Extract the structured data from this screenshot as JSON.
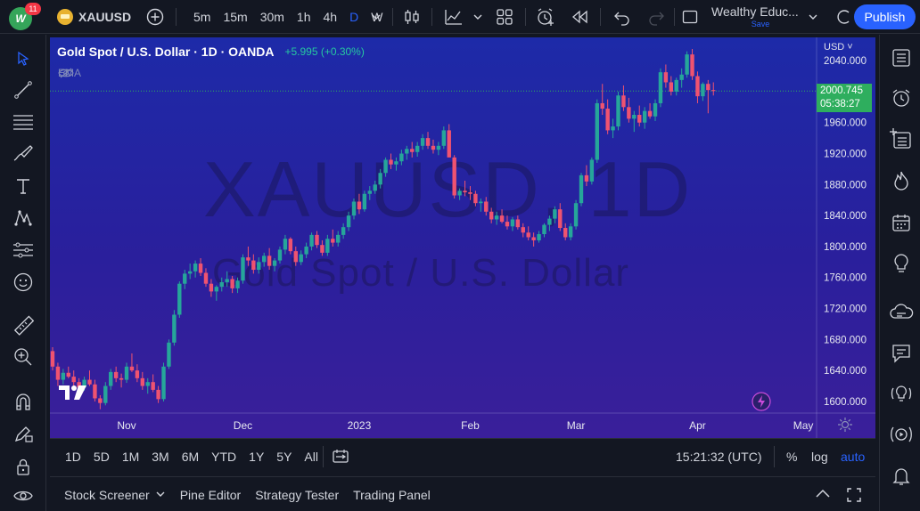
{
  "topbar": {
    "notifications": "11",
    "avatar_text": "W",
    "symbol": "XAUUSD",
    "intervals": [
      {
        "label": "5m",
        "active": false
      },
      {
        "label": "15m",
        "active": false
      },
      {
        "label": "30m",
        "active": false
      },
      {
        "label": "1h",
        "active": false
      },
      {
        "label": "4h",
        "active": false
      },
      {
        "label": "D",
        "active": true
      },
      {
        "label": "W",
        "active": false
      }
    ],
    "layout_name": "Wealthy Educ...",
    "layout_save": "Save",
    "publish_label": "Publish"
  },
  "legend": {
    "title": "Gold Spot / U.S. Dollar · 1D · OANDA",
    "change": "+5.995 (+0.30%)",
    "ema_label": "EMA"
  },
  "watermark": {
    "symbol_line": "XAUUSD, 1D",
    "name_line": "Gold Spot / U.S. Dollar"
  },
  "price_axis": {
    "currency": "USD",
    "last_price": "2000.745",
    "countdown": "05:38:27"
  },
  "chart_data": {
    "type": "candlestick",
    "ylim": [
      1585,
      2070
    ],
    "y_ticks": [
      1600,
      1640,
      1680,
      1720,
      1760,
      1800,
      1840,
      1880,
      1920,
      1960,
      2000,
      2040
    ],
    "x_labels": [
      {
        "label": "Nov",
        "index": 14
      },
      {
        "label": "Dec",
        "index": 36
      },
      {
        "label": "2023",
        "index": 58
      },
      {
        "label": "Feb",
        "index": 79
      },
      {
        "label": "Mar",
        "index": 99
      },
      {
        "label": "Apr",
        "index": 122
      },
      {
        "label": "May",
        "index": 142
      }
    ],
    "last_price": 2000.745,
    "candles": [
      [
        1665,
        1670,
        1640,
        1645
      ],
      [
        1645,
        1650,
        1620,
        1628
      ],
      [
        1628,
        1642,
        1622,
        1637
      ],
      [
        1637,
        1645,
        1630,
        1632
      ],
      [
        1632,
        1640,
        1620,
        1625
      ],
      [
        1625,
        1630,
        1612,
        1618
      ],
      [
        1618,
        1632,
        1614,
        1628
      ],
      [
        1628,
        1640,
        1620,
        1622
      ],
      [
        1622,
        1628,
        1600,
        1604
      ],
      [
        1604,
        1608,
        1590,
        1598
      ],
      [
        1598,
        1625,
        1595,
        1620
      ],
      [
        1620,
        1642,
        1615,
        1638
      ],
      [
        1638,
        1645,
        1625,
        1630
      ],
      [
        1630,
        1636,
        1618,
        1628
      ],
      [
        1628,
        1650,
        1624,
        1645
      ],
      [
        1645,
        1662,
        1638,
        1640
      ],
      [
        1640,
        1648,
        1625,
        1630
      ],
      [
        1630,
        1638,
        1615,
        1620
      ],
      [
        1620,
        1630,
        1610,
        1625
      ],
      [
        1625,
        1635,
        1612,
        1615
      ],
      [
        1615,
        1620,
        1598,
        1603
      ],
      [
        1603,
        1650,
        1600,
        1645
      ],
      [
        1645,
        1680,
        1642,
        1676
      ],
      [
        1676,
        1718,
        1672,
        1712
      ],
      [
        1712,
        1755,
        1708,
        1752
      ],
      [
        1752,
        1770,
        1745,
        1765
      ],
      [
        1765,
        1778,
        1758,
        1768
      ],
      [
        1768,
        1782,
        1760,
        1778
      ],
      [
        1778,
        1785,
        1762,
        1766
      ],
      [
        1766,
        1772,
        1748,
        1752
      ],
      [
        1752,
        1758,
        1735,
        1742
      ],
      [
        1742,
        1750,
        1730,
        1748
      ],
      [
        1748,
        1760,
        1742,
        1754
      ],
      [
        1754,
        1768,
        1748,
        1758
      ],
      [
        1758,
        1762,
        1740,
        1746
      ],
      [
        1746,
        1760,
        1740,
        1756
      ],
      [
        1756,
        1790,
        1752,
        1786
      ],
      [
        1786,
        1800,
        1775,
        1782
      ],
      [
        1782,
        1790,
        1765,
        1770
      ],
      [
        1770,
        1786,
        1765,
        1780
      ],
      [
        1780,
        1792,
        1774,
        1788
      ],
      [
        1788,
        1798,
        1770,
        1775
      ],
      [
        1775,
        1785,
        1768,
        1782
      ],
      [
        1782,
        1800,
        1778,
        1796
      ],
      [
        1796,
        1815,
        1790,
        1810
      ],
      [
        1810,
        1812,
        1790,
        1794
      ],
      [
        1794,
        1800,
        1775,
        1780
      ],
      [
        1780,
        1795,
        1776,
        1790
      ],
      [
        1790,
        1805,
        1785,
        1800
      ],
      [
        1800,
        1818,
        1795,
        1815
      ],
      [
        1815,
        1820,
        1798,
        1802
      ],
      [
        1802,
        1808,
        1788,
        1792
      ],
      [
        1792,
        1815,
        1788,
        1810
      ],
      [
        1810,
        1822,
        1800,
        1805
      ],
      [
        1805,
        1820,
        1800,
        1815
      ],
      [
        1815,
        1830,
        1810,
        1825
      ],
      [
        1825,
        1845,
        1820,
        1840
      ],
      [
        1840,
        1862,
        1835,
        1858
      ],
      [
        1858,
        1868,
        1842,
        1848
      ],
      [
        1848,
        1872,
        1845,
        1868
      ],
      [
        1868,
        1878,
        1860,
        1872
      ],
      [
        1872,
        1885,
        1868,
        1880
      ],
      [
        1880,
        1900,
        1875,
        1895
      ],
      [
        1895,
        1915,
        1890,
        1912
      ],
      [
        1912,
        1920,
        1900,
        1906
      ],
      [
        1906,
        1915,
        1898,
        1910
      ],
      [
        1910,
        1925,
        1905,
        1920
      ],
      [
        1920,
        1930,
        1912,
        1926
      ],
      [
        1926,
        1935,
        1915,
        1922
      ],
      [
        1922,
        1935,
        1916,
        1930
      ],
      [
        1930,
        1945,
        1925,
        1940
      ],
      [
        1940,
        1948,
        1926,
        1930
      ],
      [
        1930,
        1938,
        1920,
        1925
      ],
      [
        1925,
        1935,
        1918,
        1930
      ],
      [
        1930,
        1955,
        1926,
        1950
      ],
      [
        1950,
        1958,
        1920,
        1915
      ],
      [
        1915,
        1918,
        1862,
        1866
      ],
      [
        1866,
        1875,
        1860,
        1872
      ],
      [
        1872,
        1885,
        1865,
        1870
      ],
      [
        1870,
        1878,
        1860,
        1868
      ],
      [
        1868,
        1872,
        1852,
        1856
      ],
      [
        1856,
        1862,
        1845,
        1858
      ],
      [
        1858,
        1864,
        1840,
        1845
      ],
      [
        1845,
        1850,
        1830,
        1835
      ],
      [
        1835,
        1845,
        1828,
        1840
      ],
      [
        1840,
        1848,
        1830,
        1832
      ],
      [
        1832,
        1840,
        1822,
        1826
      ],
      [
        1826,
        1838,
        1820,
        1835
      ],
      [
        1835,
        1840,
        1822,
        1825
      ],
      [
        1825,
        1830,
        1812,
        1818
      ],
      [
        1818,
        1826,
        1808,
        1812
      ],
      [
        1812,
        1818,
        1800,
        1808
      ],
      [
        1808,
        1820,
        1805,
        1816
      ],
      [
        1816,
        1830,
        1812,
        1828
      ],
      [
        1828,
        1840,
        1820,
        1836
      ],
      [
        1836,
        1852,
        1830,
        1848
      ],
      [
        1848,
        1856,
        1820,
        1824
      ],
      [
        1824,
        1830,
        1808,
        1812
      ],
      [
        1812,
        1830,
        1808,
        1826
      ],
      [
        1826,
        1860,
        1822,
        1856
      ],
      [
        1856,
        1895,
        1852,
        1892
      ],
      [
        1892,
        1905,
        1878,
        1884
      ],
      [
        1884,
        1915,
        1880,
        1912
      ],
      [
        1912,
        1990,
        1908,
        1985
      ],
      [
        1985,
        2010,
        1970,
        1978
      ],
      [
        1978,
        1990,
        1945,
        1950
      ],
      [
        1950,
        1965,
        1940,
        1955
      ],
      [
        1955,
        2000,
        1950,
        1995
      ],
      [
        1995,
        2008,
        1975,
        1980
      ],
      [
        1980,
        1992,
        1960,
        1965
      ],
      [
        1965,
        1975,
        1948,
        1970
      ],
      [
        1970,
        1982,
        1955,
        1960
      ],
      [
        1960,
        1980,
        1952,
        1975
      ],
      [
        1975,
        1985,
        1965,
        1968
      ],
      [
        1968,
        1990,
        1962,
        1985
      ],
      [
        1985,
        2030,
        1980,
        2025
      ],
      [
        2025,
        2035,
        2005,
        2012
      ],
      [
        2012,
        2020,
        1995,
        2000
      ],
      [
        2000,
        2018,
        1995,
        2015
      ],
      [
        2015,
        2030,
        2005,
        2022
      ],
      [
        2022,
        2052,
        2018,
        2048
      ],
      [
        2048,
        2055,
        2015,
        2020
      ],
      [
        2020,
        2026,
        1985,
        1994
      ],
      [
        1994,
        2012,
        1988,
        2010
      ],
      [
        2010,
        2015,
        1972,
        2002
      ],
      [
        2002,
        2012,
        1995,
        2000.745
      ]
    ]
  },
  "datebar": {
    "ranges": [
      "1D",
      "5D",
      "1M",
      "3M",
      "6M",
      "YTD",
      "1Y",
      "5Y",
      "All"
    ],
    "time": "15:21:32 (UTC)",
    "percent": "%",
    "log": "log",
    "auto": "auto"
  },
  "bottom_panel": {
    "tabs": [
      "Stock Screener",
      "Pine Editor",
      "Strategy Tester",
      "Trading Panel"
    ]
  },
  "colors": {
    "up": "#26a69a",
    "down": "#ef5370",
    "accent": "#2962ff",
    "price_badge": "#2eae5e"
  }
}
